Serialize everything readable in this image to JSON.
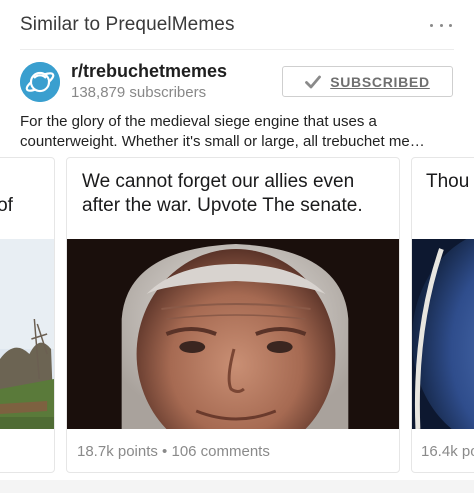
{
  "header": {
    "title": "Similar to PrequelMemes",
    "more_icon": "more-dots-icon"
  },
  "community": {
    "icon": "planet-icon",
    "name": "r/trebuchetmemes",
    "subscribers": "138,879 subscribers",
    "button_label": "SUBSCRIBED",
    "button_icon": "checkmark-icon",
    "description": "For the glory of the medieval siege engine that uses a counterweight. Whether it's small or large, all trebuchet me…"
  },
  "cards": {
    "left": {
      "title": "o of\no",
      "meta": ""
    },
    "main": {
      "title": "We cannot forget our allies even after the war. Upvote The senate.",
      "meta": "18.7k points • 106 comments"
    },
    "right": {
      "title": "Thou",
      "meta": "16.4k po"
    }
  },
  "colors": {
    "accent": "#3a9fcf",
    "muted_text": "#8a8a8a",
    "border": "#e6e6e6"
  }
}
